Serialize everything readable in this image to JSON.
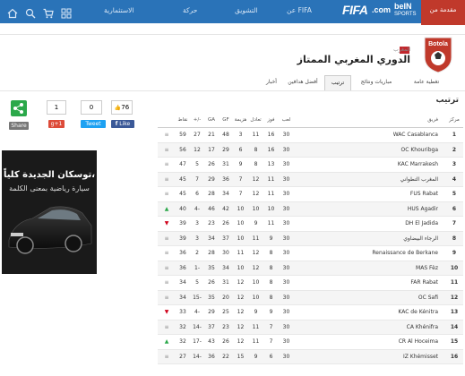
{
  "topbar": {
    "nav": [
      {
        "label": "الاستثمارية"
      },
      {
        "label": "حركة"
      },
      {
        "label": "التشويق"
      },
      {
        "label": "عن FIFA"
      }
    ],
    "sport_tab": "مقدمة من",
    "fifa": "FIFA",
    "com": ".com",
    "bein": "beIN",
    "bein_sub": "SPORTS"
  },
  "league": {
    "country": "المغرب",
    "name": "الدوري المغربي الممتاز",
    "club_logo_text": "Botola",
    "tabs": [
      {
        "label": "أخبار"
      },
      {
        "label": "أفضل هدافين"
      },
      {
        "label": "ترتيب",
        "active": true
      },
      {
        "label": "مباريات ونتائج"
      },
      {
        "label": "تغطية عامة"
      }
    ]
  },
  "social": {
    "share_label": "Share",
    "gplus_count": "1",
    "gplus_label": "g+1",
    "tweet_count": "0",
    "tweet_label": "Tweet",
    "like_count": "76",
    "like_label": "Like"
  },
  "standings": {
    "title": "ترتيب",
    "headers": {
      "trend": "",
      "points": "نقاط",
      "gd": "+/-",
      "ga": "GA",
      "gf": "GF",
      "lost": "هزيمة",
      "drawn": "تعادل",
      "won": "فوز",
      "played": "لعب",
      "team": "فريق",
      "pos": "مركز"
    },
    "rows": [
      {
        "trend": "same",
        "points": "59",
        "gd": "27",
        "ga": "21",
        "gf": "48",
        "lost": "3",
        "drawn": "11",
        "won": "16",
        "played": "30",
        "team": "WAC Casablanca",
        "pos": "1"
      },
      {
        "trend": "same",
        "points": "56",
        "gd": "12",
        "ga": "17",
        "gf": "29",
        "lost": "6",
        "drawn": "8",
        "won": "16",
        "played": "30",
        "team": "OC Khouribga",
        "pos": "2"
      },
      {
        "trend": "same",
        "points": "47",
        "gd": "5",
        "ga": "26",
        "gf": "31",
        "lost": "9",
        "drawn": "8",
        "won": "13",
        "played": "30",
        "team": "KAC Marrakesh",
        "pos": "3"
      },
      {
        "trend": "same",
        "points": "45",
        "gd": "7",
        "ga": "29",
        "gf": "36",
        "lost": "7",
        "drawn": "12",
        "won": "11",
        "played": "30",
        "team": "المغرب التطواني",
        "pos": "4"
      },
      {
        "trend": "same",
        "points": "45",
        "gd": "6",
        "ga": "28",
        "gf": "34",
        "lost": "7",
        "drawn": "12",
        "won": "11",
        "played": "30",
        "team": "FUS Rabat",
        "pos": "5"
      },
      {
        "trend": "up",
        "points": "40",
        "gd": "4-",
        "ga": "46",
        "gf": "42",
        "lost": "10",
        "drawn": "10",
        "won": "10",
        "played": "30",
        "team": "HUS Agadir",
        "pos": "6"
      },
      {
        "trend": "down",
        "points": "39",
        "gd": "3",
        "ga": "23",
        "gf": "26",
        "lost": "10",
        "drawn": "9",
        "won": "11",
        "played": "30",
        "team": "DH El Jadida",
        "pos": "7"
      },
      {
        "trend": "same",
        "points": "39",
        "gd": "3",
        "ga": "34",
        "gf": "37",
        "lost": "10",
        "drawn": "11",
        "won": "9",
        "played": "30",
        "team": "الرجاء البيضاوي",
        "pos": "8"
      },
      {
        "trend": "same",
        "points": "36",
        "gd": "2",
        "ga": "28",
        "gf": "30",
        "lost": "11",
        "drawn": "12",
        "won": "8",
        "played": "30",
        "team": "Renaissance de Berkane",
        "pos": "9"
      },
      {
        "trend": "same",
        "points": "36",
        "gd": "1-",
        "ga": "35",
        "gf": "34",
        "lost": "10",
        "drawn": "12",
        "won": "8",
        "played": "30",
        "team": "MAS Fèz",
        "pos": "10"
      },
      {
        "trend": "same",
        "points": "34",
        "gd": "5",
        "ga": "26",
        "gf": "31",
        "lost": "12",
        "drawn": "10",
        "won": "8",
        "played": "30",
        "team": "FAR Rabat",
        "pos": "11"
      },
      {
        "trend": "same",
        "points": "34",
        "gd": "15-",
        "ga": "35",
        "gf": "20",
        "lost": "12",
        "drawn": "10",
        "won": "8",
        "played": "30",
        "team": "OC Safi",
        "pos": "12"
      },
      {
        "trend": "down",
        "points": "33",
        "gd": "4-",
        "ga": "29",
        "gf": "25",
        "lost": "12",
        "drawn": "9",
        "won": "9",
        "played": "30",
        "team": "KAC de Kénitra",
        "pos": "13"
      },
      {
        "trend": "same",
        "points": "32",
        "gd": "14-",
        "ga": "37",
        "gf": "23",
        "lost": "12",
        "drawn": "11",
        "won": "7",
        "played": "30",
        "team": "CA Khénifra",
        "pos": "14"
      },
      {
        "trend": "up",
        "points": "32",
        "gd": "17-",
        "ga": "43",
        "gf": "26",
        "lost": "12",
        "drawn": "11",
        "won": "7",
        "played": "30",
        "team": "CR Al Hoceima",
        "pos": "15"
      },
      {
        "trend": "same",
        "points": "27",
        "gd": "14-",
        "ga": "36",
        "gf": "22",
        "lost": "15",
        "drawn": "9",
        "won": "6",
        "played": "30",
        "team": "IZ Khémisset",
        "pos": "16"
      }
    ]
  },
  "ad": {
    "line1": "توسكان الجديدة كلياً،",
    "line2": "سيارة رياضية بمعنى الكلمة"
  },
  "colors": {
    "topbar": "#2a73b8",
    "accent_red": "#c0392b",
    "trend_up": "#2ba84a",
    "trend_down": "#d0021b"
  }
}
